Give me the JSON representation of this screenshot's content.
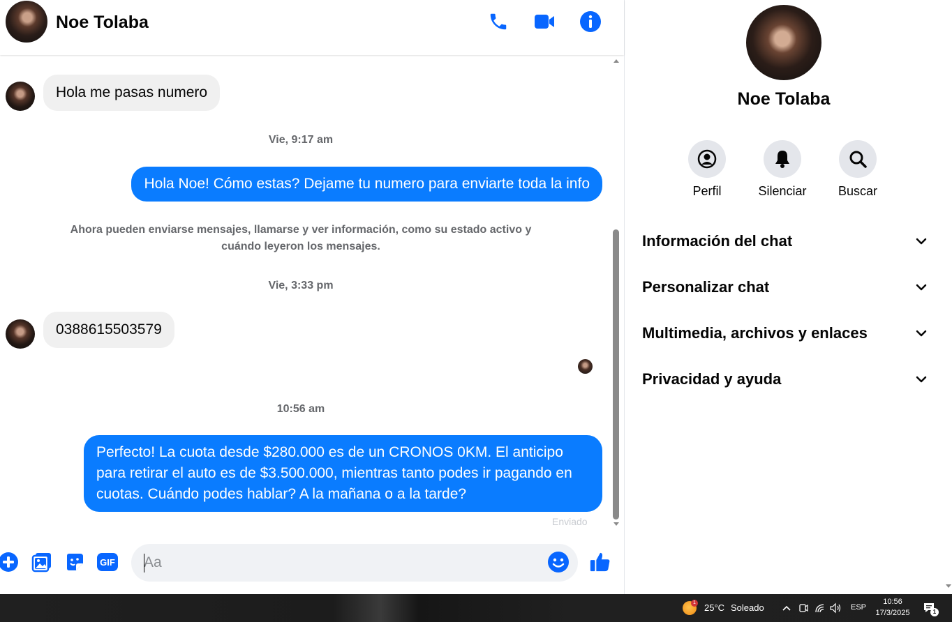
{
  "header": {
    "contact_name": "Noe Tolaba",
    "icons": [
      "phone-icon",
      "video-camera-icon",
      "info-icon"
    ]
  },
  "messages": [
    {
      "direction": "in",
      "text": "Hola me pasas numero"
    },
    {
      "type": "timestamp",
      "text": "Vie, 9:17 am"
    },
    {
      "direction": "out",
      "text": "Hola Noe! Cómo estas? Dejame tu numero para enviarte toda la info"
    },
    {
      "type": "system",
      "text": "Ahora pueden enviarse mensajes, llamarse y ver información, como su estado activo y cuándo leyeron los mensajes."
    },
    {
      "type": "timestamp",
      "text": "Vie, 3:33 pm"
    },
    {
      "direction": "in",
      "text": "0388615503579"
    },
    {
      "type": "timestamp",
      "text": "10:56 am"
    },
    {
      "direction": "out",
      "text": "Perfecto! La cuota desde $280.000 es de un CRONOS 0KM. El anticipo para retirar el auto es de $3.500.000, mientras tanto podes ir pagando en cuotas. Cuándo podes hablar? A la mañana o a la tarde?"
    }
  ],
  "status": {
    "sent_label": "Enviado"
  },
  "composer": {
    "placeholder": "Aa",
    "icons": [
      "plus-icon",
      "image-icon",
      "sticker-icon",
      "gif-icon",
      "emoji-icon",
      "thumbs-up-icon"
    ],
    "gif_label": "GIF"
  },
  "panel": {
    "name": "Noe Tolaba",
    "actions": [
      {
        "label": "Perfil",
        "icon": "profile-icon"
      },
      {
        "label": "Silenciar",
        "icon": "bell-icon"
      },
      {
        "label": "Buscar",
        "icon": "search-icon"
      }
    ],
    "sections": [
      {
        "title": "Información del chat"
      },
      {
        "title": "Personalizar chat"
      },
      {
        "title": "Multimedia, archivos y enlaces"
      },
      {
        "title": "Privacidad y ayuda"
      }
    ]
  },
  "taskbar": {
    "weather_temp": "25°C",
    "weather_text": "Soleado",
    "weather_badge": "1",
    "language": "ESP",
    "time": "10:56",
    "date": "17/3/2025",
    "notification_count": "1"
  },
  "colors": {
    "accent": "#0a7cff",
    "icon_blue": "#0866ff",
    "incoming_bubble": "#f0f0f0",
    "secondary_text": "#65676b"
  }
}
